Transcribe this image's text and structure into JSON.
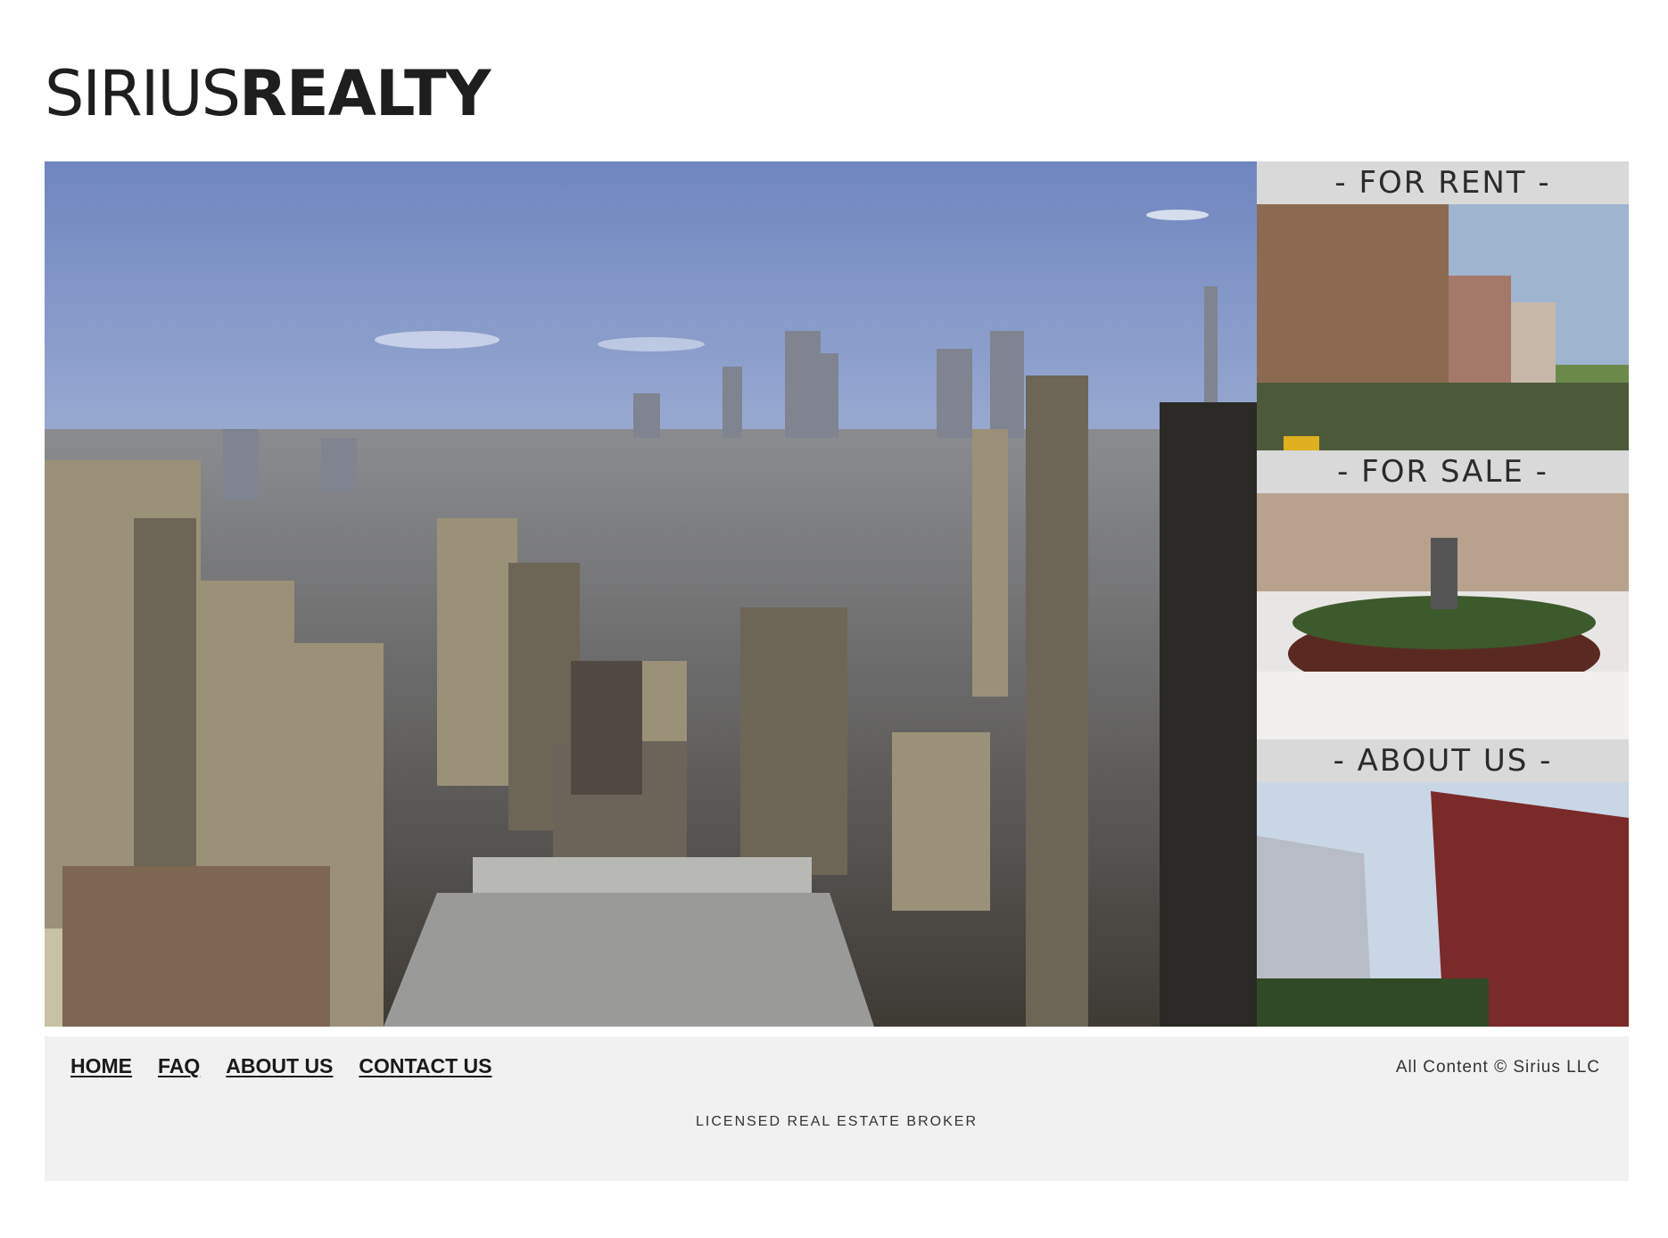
{
  "brand": {
    "name_light": "SIRIUS",
    "name_bold": "REALTY"
  },
  "tiles": [
    {
      "label": "- FOR RENT -"
    },
    {
      "label": "- FOR SALE -"
    },
    {
      "label": "- ABOUT US -"
    }
  ],
  "footer": {
    "nav": [
      "HOME",
      "FAQ",
      "ABOUT US",
      "CONTACT US"
    ],
    "copyright": "All Content © Sirius LLC",
    "license": "LICENSED REAL ESTATE BROKER"
  }
}
